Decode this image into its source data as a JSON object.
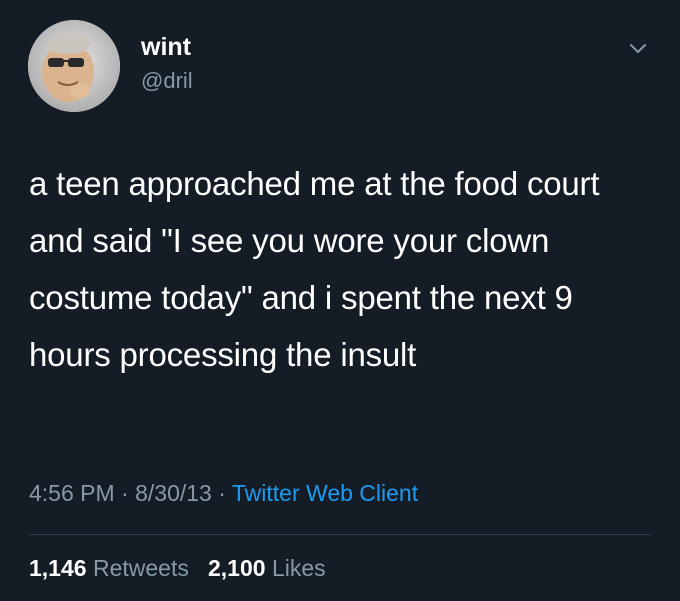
{
  "author": {
    "name": "wint",
    "handle": "@dril",
    "avatar_icon": "profile-photo"
  },
  "tweet": {
    "text": "a teen approached me at the food court and said \"I see you wore your clown costume today\" and i spent the next 9 hours processing the insult",
    "time": "4:56 PM",
    "date": "8/30/13",
    "separator": "·",
    "client": "Twitter Web Client"
  },
  "stats": {
    "retweets_count": "1,146",
    "retweets_label": "Retweets",
    "likes_count": "2,100",
    "likes_label": "Likes"
  },
  "colors": {
    "background": "#141c26",
    "text": "#ffffff",
    "muted": "#8899a6",
    "link": "#1d9bf0"
  },
  "icons": {
    "menu": "chevron-down-icon"
  }
}
